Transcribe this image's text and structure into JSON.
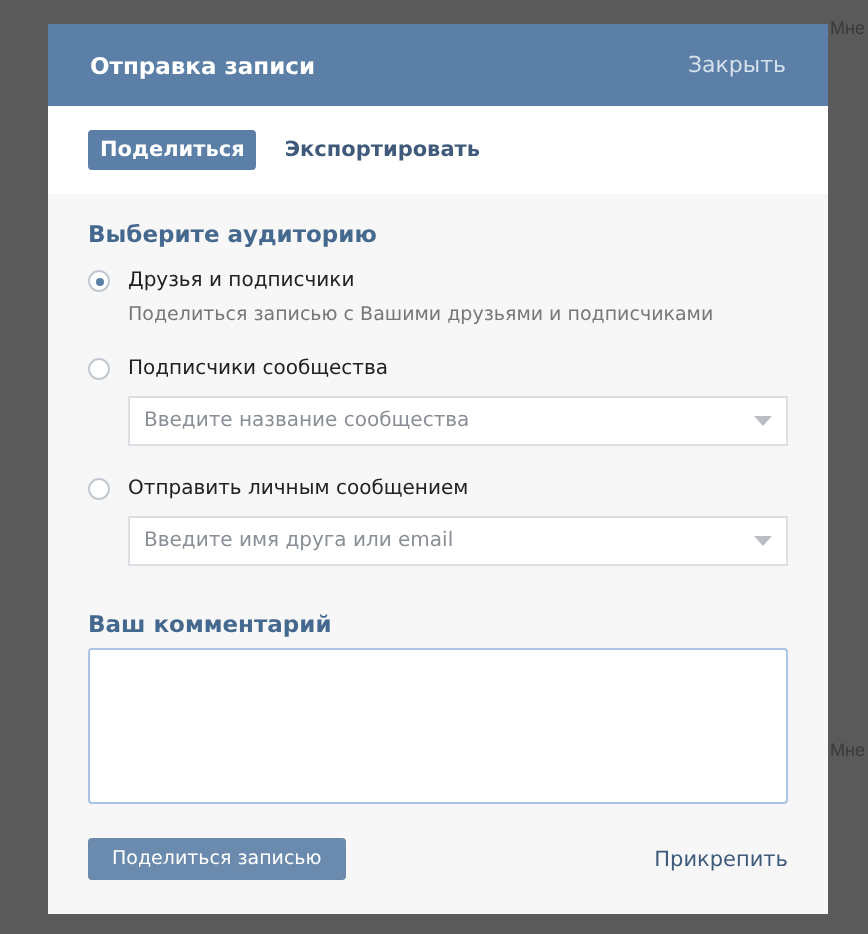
{
  "background": {
    "labels": [
      "Мне",
      "Мне"
    ]
  },
  "dialog": {
    "title": "Отправка записи",
    "close": "Закрыть"
  },
  "tabs": [
    {
      "label": "Поделиться",
      "selected": true
    },
    {
      "label": "Экспортировать",
      "selected": false
    }
  ],
  "audience": {
    "heading": "Выберите аудиторию",
    "options": [
      {
        "label": "Друзья и подписчики",
        "selected": true,
        "description": "Поделиться записью с Вашими друзьями и подписчиками"
      },
      {
        "label": "Подписчики сообщества",
        "selected": false,
        "placeholder": "Введите название сообщества"
      },
      {
        "label": "Отправить личным сообщением",
        "selected": false,
        "placeholder": "Введите имя друга или email"
      }
    ]
  },
  "comment": {
    "heading": "Ваш комментарий"
  },
  "footer": {
    "submit": "Поделиться записью",
    "attach": "Прикрепить"
  }
}
